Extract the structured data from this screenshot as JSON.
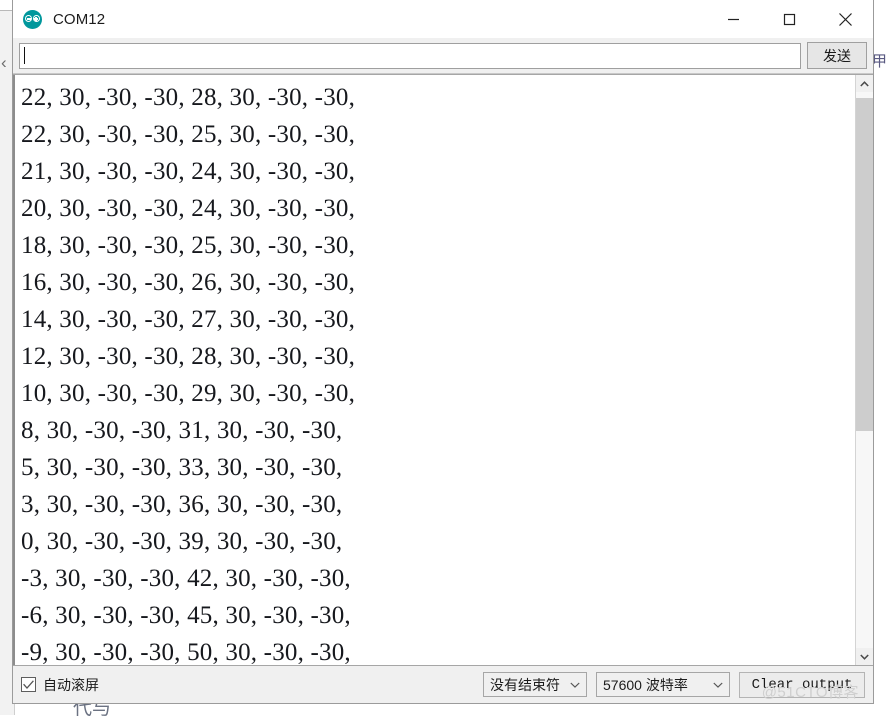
{
  "window": {
    "title": "COM12",
    "logo_icon": "arduino-logo-icon",
    "minimize_label": "–",
    "maximize_label": "□",
    "close_label": "×"
  },
  "send_row": {
    "input_value": "",
    "input_placeholder": "",
    "send_label": "发送"
  },
  "output": {
    "lines": [
      "22, 30, -30, -30, 28, 30, -30, -30,",
      "22, 30, -30, -30, 25, 30, -30, -30,",
      "21, 30, -30, -30, 24, 30, -30, -30,",
      "20, 30, -30, -30, 24, 30, -30, -30,",
      "18, 30, -30, -30, 25, 30, -30, -30,",
      "16, 30, -30, -30, 26, 30, -30, -30,",
      "14, 30, -30, -30, 27, 30, -30, -30,",
      "12, 30, -30, -30, 28, 30, -30, -30,",
      "10, 30, -30, -30, 29, 30, -30, -30,",
      "8, 30, -30, -30, 31, 30, -30, -30,",
      "5, 30, -30, -30, 33, 30, -30, -30,",
      "3, 30, -30, -30, 36, 30, -30, -30,",
      "0, 30, -30, -30, 39, 30, -30, -30,",
      "-3, 30, -30, -30, 42, 30, -30, -30,",
      "-6, 30, -30, -30, 45, 30, -30, -30,",
      "-9, 30, -30, -30, 50, 30, -30, -30,"
    ]
  },
  "scrollbar": {
    "up_icon": "chevron-up-icon",
    "down_icon": "chevron-down-icon",
    "thumb_top_percent": 1,
    "thumb_height_percent": 60
  },
  "bottom_bar": {
    "autoscroll_label": "自动滚屏",
    "autoscroll_checked": true,
    "line_ending": {
      "value": "没有结束符",
      "arrow_icon": "chevron-down-icon"
    },
    "baud_rate": {
      "value": "57600 波特率",
      "arrow_icon": "chevron-down-icon"
    },
    "clear_output_label": "Clear output",
    "watermark": "@51CTO博客"
  },
  "background": {
    "left_chevron": "‹",
    "right_glyph": "甲",
    "bottom_text": "代与"
  },
  "colors": {
    "accent_teal": "#00979C",
    "window_chrome": "#F0F0F0",
    "output_bg": "#FFFFFF",
    "text": "#16181D"
  }
}
